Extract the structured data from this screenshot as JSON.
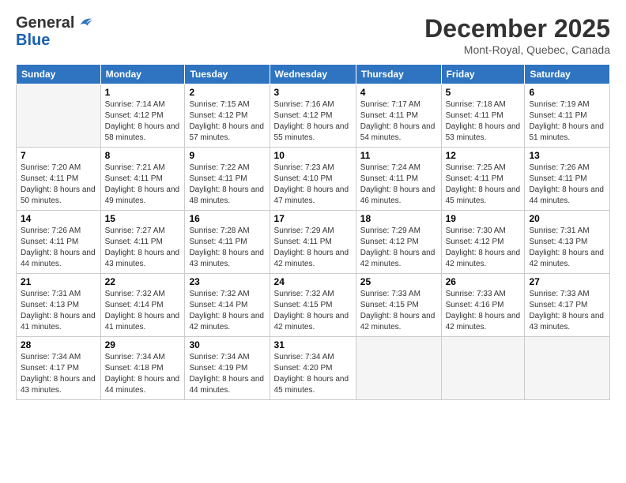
{
  "logo": {
    "line1": "General",
    "line2": "Blue"
  },
  "title": "December 2025",
  "location": "Mont-Royal, Quebec, Canada",
  "days_header": [
    "Sunday",
    "Monday",
    "Tuesday",
    "Wednesday",
    "Thursday",
    "Friday",
    "Saturday"
  ],
  "weeks": [
    [
      {
        "num": "",
        "empty": true
      },
      {
        "num": "1",
        "sunrise": "7:14 AM",
        "sunset": "4:12 PM",
        "daylight": "8 hours and 58 minutes."
      },
      {
        "num": "2",
        "sunrise": "7:15 AM",
        "sunset": "4:12 PM",
        "daylight": "8 hours and 57 minutes."
      },
      {
        "num": "3",
        "sunrise": "7:16 AM",
        "sunset": "4:12 PM",
        "daylight": "8 hours and 55 minutes."
      },
      {
        "num": "4",
        "sunrise": "7:17 AM",
        "sunset": "4:11 PM",
        "daylight": "8 hours and 54 minutes."
      },
      {
        "num": "5",
        "sunrise": "7:18 AM",
        "sunset": "4:11 PM",
        "daylight": "8 hours and 53 minutes."
      },
      {
        "num": "6",
        "sunrise": "7:19 AM",
        "sunset": "4:11 PM",
        "daylight": "8 hours and 51 minutes."
      }
    ],
    [
      {
        "num": "7",
        "sunrise": "7:20 AM",
        "sunset": "4:11 PM",
        "daylight": "8 hours and 50 minutes."
      },
      {
        "num": "8",
        "sunrise": "7:21 AM",
        "sunset": "4:11 PM",
        "daylight": "8 hours and 49 minutes."
      },
      {
        "num": "9",
        "sunrise": "7:22 AM",
        "sunset": "4:11 PM",
        "daylight": "8 hours and 48 minutes."
      },
      {
        "num": "10",
        "sunrise": "7:23 AM",
        "sunset": "4:10 PM",
        "daylight": "8 hours and 47 minutes."
      },
      {
        "num": "11",
        "sunrise": "7:24 AM",
        "sunset": "4:11 PM",
        "daylight": "8 hours and 46 minutes."
      },
      {
        "num": "12",
        "sunrise": "7:25 AM",
        "sunset": "4:11 PM",
        "daylight": "8 hours and 45 minutes."
      },
      {
        "num": "13",
        "sunrise": "7:26 AM",
        "sunset": "4:11 PM",
        "daylight": "8 hours and 44 minutes."
      }
    ],
    [
      {
        "num": "14",
        "sunrise": "7:26 AM",
        "sunset": "4:11 PM",
        "daylight": "8 hours and 44 minutes."
      },
      {
        "num": "15",
        "sunrise": "7:27 AM",
        "sunset": "4:11 PM",
        "daylight": "8 hours and 43 minutes."
      },
      {
        "num": "16",
        "sunrise": "7:28 AM",
        "sunset": "4:11 PM",
        "daylight": "8 hours and 43 minutes."
      },
      {
        "num": "17",
        "sunrise": "7:29 AM",
        "sunset": "4:11 PM",
        "daylight": "8 hours and 42 minutes."
      },
      {
        "num": "18",
        "sunrise": "7:29 AM",
        "sunset": "4:12 PM",
        "daylight": "8 hours and 42 minutes."
      },
      {
        "num": "19",
        "sunrise": "7:30 AM",
        "sunset": "4:12 PM",
        "daylight": "8 hours and 42 minutes."
      },
      {
        "num": "20",
        "sunrise": "7:31 AM",
        "sunset": "4:13 PM",
        "daylight": "8 hours and 42 minutes."
      }
    ],
    [
      {
        "num": "21",
        "sunrise": "7:31 AM",
        "sunset": "4:13 PM",
        "daylight": "8 hours and 41 minutes."
      },
      {
        "num": "22",
        "sunrise": "7:32 AM",
        "sunset": "4:14 PM",
        "daylight": "8 hours and 41 minutes."
      },
      {
        "num": "23",
        "sunrise": "7:32 AM",
        "sunset": "4:14 PM",
        "daylight": "8 hours and 42 minutes."
      },
      {
        "num": "24",
        "sunrise": "7:32 AM",
        "sunset": "4:15 PM",
        "daylight": "8 hours and 42 minutes."
      },
      {
        "num": "25",
        "sunrise": "7:33 AM",
        "sunset": "4:15 PM",
        "daylight": "8 hours and 42 minutes."
      },
      {
        "num": "26",
        "sunrise": "7:33 AM",
        "sunset": "4:16 PM",
        "daylight": "8 hours and 42 minutes."
      },
      {
        "num": "27",
        "sunrise": "7:33 AM",
        "sunset": "4:17 PM",
        "daylight": "8 hours and 43 minutes."
      }
    ],
    [
      {
        "num": "28",
        "sunrise": "7:34 AM",
        "sunset": "4:17 PM",
        "daylight": "8 hours and 43 minutes."
      },
      {
        "num": "29",
        "sunrise": "7:34 AM",
        "sunset": "4:18 PM",
        "daylight": "8 hours and 44 minutes."
      },
      {
        "num": "30",
        "sunrise": "7:34 AM",
        "sunset": "4:19 PM",
        "daylight": "8 hours and 44 minutes."
      },
      {
        "num": "31",
        "sunrise": "7:34 AM",
        "sunset": "4:20 PM",
        "daylight": "8 hours and 45 minutes."
      },
      {
        "num": "",
        "empty": true
      },
      {
        "num": "",
        "empty": true
      },
      {
        "num": "",
        "empty": true
      }
    ]
  ]
}
